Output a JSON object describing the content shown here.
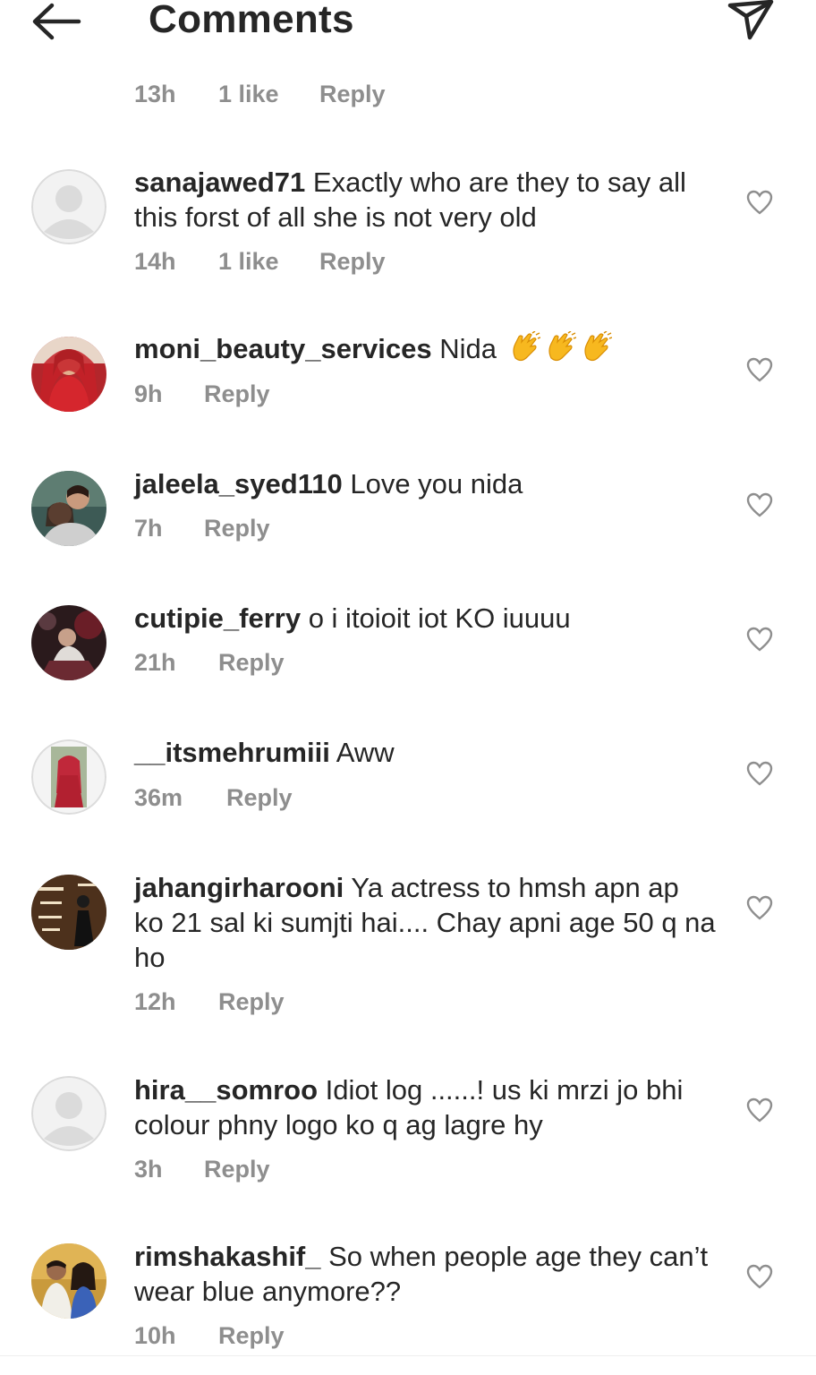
{
  "header": {
    "title": "Comments",
    "back_icon": "arrow-left-icon",
    "share_icon": "paper-plane-icon"
  },
  "top_meta": {
    "time": "13h",
    "likes": "1 like",
    "reply": "Reply"
  },
  "comments": [
    {
      "username": "sanajawed71",
      "text": "Exactly who are they to say all this forst of all she is not very old",
      "time": "14h",
      "likes": "1 like",
      "reply": "Reply",
      "avatar": "default-avatar"
    },
    {
      "username": "moni_beauty_services",
      "text": "Nida",
      "emoji": "clapping-hands x3",
      "time": "9h",
      "reply": "Reply",
      "avatar": "photo-avatar"
    },
    {
      "username": "jaleela_syed110",
      "text": "Love you nida",
      "time": "7h",
      "reply": "Reply",
      "avatar": "photo-avatar"
    },
    {
      "username": "cutipie_ferry",
      "text": "o i itoioit iot KO iuuuu",
      "time": "21h",
      "reply": "Reply",
      "avatar": "photo-avatar"
    },
    {
      "username": "__itsmehrumiii",
      "text": "Aww",
      "time": "36m",
      "reply": "Reply",
      "avatar": "photo-avatar"
    },
    {
      "username": "jahangirharooni",
      "text": "Ya actress to hmsh apn ap ko 21 sal ki sumjti hai.... Chay apni age 50 q na ho",
      "time": "12h",
      "reply": "Reply",
      "avatar": "photo-avatar"
    },
    {
      "username": "hira__somroo",
      "text": "Idiot log ......! us ki mrzi jo bhi colour phny  logo ko q ag lagre hy",
      "time": "3h",
      "reply": "Reply",
      "avatar": "default-avatar"
    },
    {
      "username": "rimshakashif_",
      "text": "So when people age they can’t wear blue anymore??",
      "time": "10h",
      "reply": "Reply",
      "avatar": "photo-avatar"
    }
  ],
  "colors": {
    "text": "#262626",
    "meta": "#8e8e8e",
    "heart": "#8e8e8e"
  },
  "like_icon": "heart-outline-icon"
}
